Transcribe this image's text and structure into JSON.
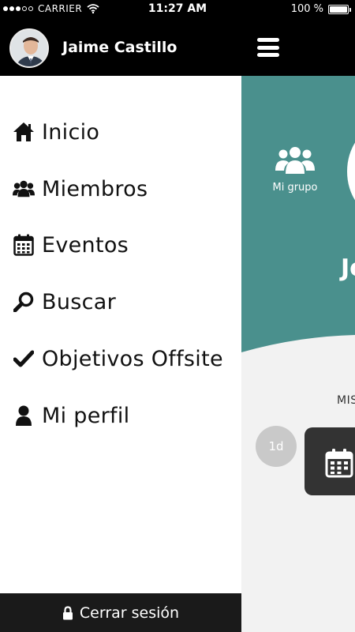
{
  "status_bar": {
    "carrier": "CARRIER",
    "time": "11:27 AM",
    "battery": "100 %",
    "battery_level": 1.0
  },
  "header": {
    "user_name": "Jaime Castillo",
    "menu_icon": "hamburger-icon"
  },
  "menu": {
    "items": [
      {
        "label": "Inicio",
        "icon": "home-icon"
      },
      {
        "label": "Miembros",
        "icon": "users-icon"
      },
      {
        "label": "Eventos",
        "icon": "calendar-icon"
      },
      {
        "label": "Buscar",
        "icon": "search-icon"
      },
      {
        "label": "Objetivos Offsite",
        "icon": "check-icon"
      },
      {
        "label": "Mi perfil",
        "icon": "user-icon"
      }
    ],
    "logout_label": "Cerrar sesión",
    "logout_icon": "lock-icon"
  },
  "background": {
    "group_label": "Mi grupo",
    "name_peek": "Jo",
    "section_peek": "MIS",
    "days_badge": "1d"
  },
  "colors": {
    "accent": "#4a908d",
    "dark": "#000000",
    "drawer": "#ffffff",
    "logout_bar": "#1a1a1a"
  }
}
